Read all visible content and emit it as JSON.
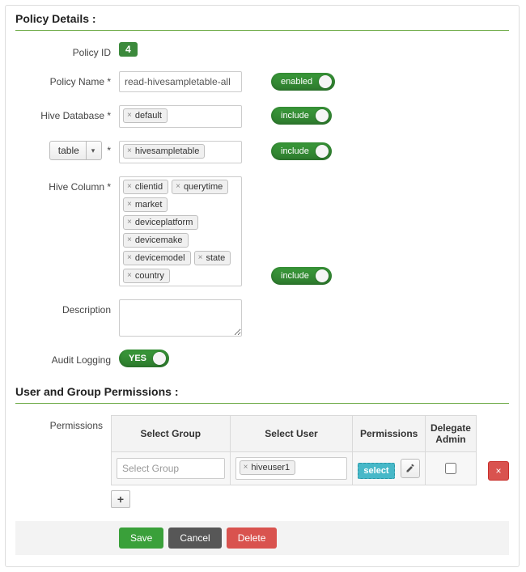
{
  "section1_title": "Policy Details :",
  "section2_title": "User and Group Permissions :",
  "labels": {
    "policy_id": "Policy ID",
    "policy_name": "Policy Name *",
    "hive_database": "Hive Database *",
    "table_dropdown": "table",
    "table_asterisk": "*",
    "hive_column": "Hive Column *",
    "description": "Description",
    "audit_logging": "Audit Logging",
    "permissions": "Permissions"
  },
  "toggles": {
    "enabled": "enabled",
    "include1": "include",
    "include2": "include",
    "include3": "include",
    "yes": "YES"
  },
  "policy": {
    "id": "4",
    "name": "read-hivesampletable-all",
    "databases": [
      "default"
    ],
    "tables": [
      "hivesampletable"
    ],
    "columns": [
      "clientid",
      "querytime",
      "market",
      "deviceplatform",
      "devicemake",
      "devicemodel",
      "state",
      "country"
    ],
    "description": ""
  },
  "perm_table": {
    "headers": {
      "group": "Select Group",
      "user": "Select User",
      "perm": "Permissions",
      "delegate": "Delegate Admin"
    },
    "row": {
      "group_placeholder": "Select Group",
      "users": [
        "hiveuser1"
      ],
      "perm_chip": "select",
      "delegate_checked": false
    }
  },
  "buttons": {
    "save": "Save",
    "cancel": "Cancel",
    "delete": "Delete",
    "add": "+",
    "remove": "×"
  }
}
